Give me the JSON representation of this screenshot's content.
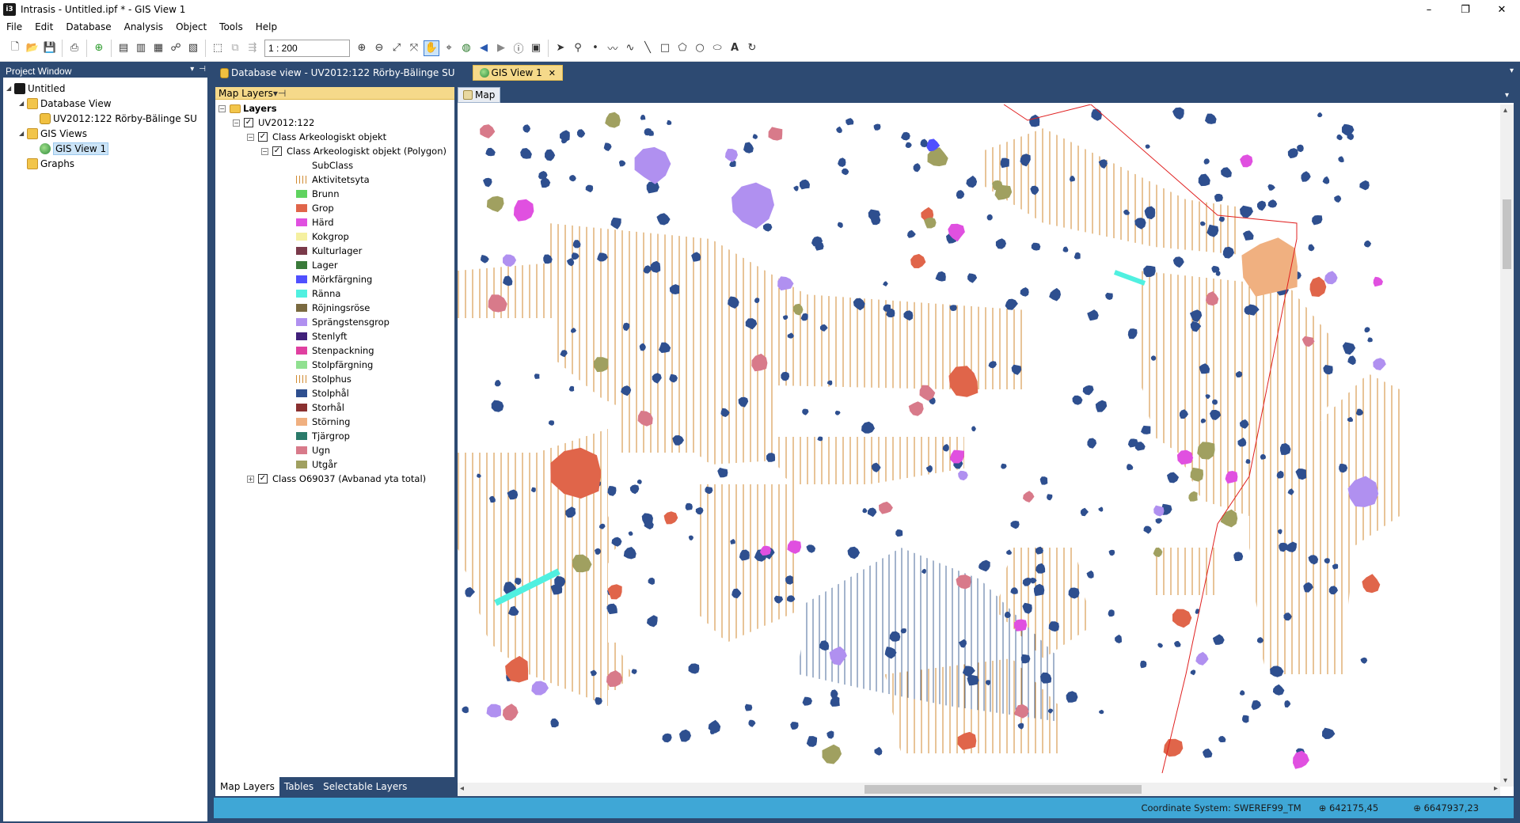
{
  "window": {
    "title": "Intrasis - Untitled.ipf * - GIS View 1",
    "app_icon": "i3"
  },
  "menu": [
    "File",
    "Edit",
    "Database",
    "Analysis",
    "Object",
    "Tools",
    "Help"
  ],
  "toolbar": {
    "scale_value": "1 : 200"
  },
  "project_window": {
    "title": "Project Window",
    "tree": [
      {
        "label": "Untitled",
        "icon": "app-icon",
        "level": 0,
        "expanded": true
      },
      {
        "label": "Database View",
        "icon": "folder-icon",
        "level": 1,
        "expanded": true
      },
      {
        "label": "UV2012:122 Rörby-Bälinge SU",
        "icon": "database-icon",
        "level": 2
      },
      {
        "label": "GIS Views",
        "icon": "folder-icon",
        "level": 1,
        "expanded": true
      },
      {
        "label": "GIS View 1",
        "icon": "globe-icon",
        "level": 2,
        "selected": true
      },
      {
        "label": "Graphs",
        "icon": "folder-icon",
        "level": 1
      }
    ]
  },
  "doc_tabs": [
    {
      "label": "Database view - UV2012:122 Rörby-Bälinge SU",
      "active": false
    },
    {
      "label": "GIS View 1",
      "active": true
    }
  ],
  "map_layers": {
    "title": "Map Layers",
    "root": "Layers",
    "project": "UV2012:122",
    "class1": "Class Arkeologiskt objekt",
    "class1_sub": "Class Arkeologiskt objekt (Polygon)",
    "subclass_header": "SubClass",
    "legend": [
      {
        "label": "Aktivitetsyta",
        "color": "hatch"
      },
      {
        "label": "Brunn",
        "color": "#5fd35f"
      },
      {
        "label": "Grop",
        "color": "#e0654a"
      },
      {
        "label": "Härd",
        "color": "#e050e0"
      },
      {
        "label": "Kokgrop",
        "color": "#f5f0a0"
      },
      {
        "label": "Kulturlager",
        "color": "#7a3a4a"
      },
      {
        "label": "Lager",
        "color": "#3a7a3a"
      },
      {
        "label": "Mörkfärgning",
        "color": "#5050ff"
      },
      {
        "label": "Ränna",
        "color": "#50f0e0"
      },
      {
        "label": "Röjningsröse",
        "color": "#7a6a40"
      },
      {
        "label": "Sprängstensgrop",
        "color": "#b090f0"
      },
      {
        "label": "Stenlyft",
        "color": "#40207a"
      },
      {
        "label": "Stenpackning",
        "color": "#e040a0"
      },
      {
        "label": "Stolpfärgning",
        "color": "#90e090"
      },
      {
        "label": "Stolphus",
        "color": "hatch"
      },
      {
        "label": "Stolphål",
        "color": "#2e4f8f"
      },
      {
        "label": "Storhål",
        "color": "#8a3030"
      },
      {
        "label": "Störning",
        "color": "#f0b080"
      },
      {
        "label": "Tjärgrop",
        "color": "#2a7a6a"
      },
      {
        "label": "Ugn",
        "color": "#d87a8a"
      },
      {
        "label": "Utgår",
        "color": "#a0a060"
      }
    ],
    "class2": "Class O69037 (Avbanad yta total)",
    "bottom_tabs": [
      "Map Layers",
      "Tables",
      "Selectable Layers"
    ]
  },
  "map": {
    "tab_label": "Map"
  },
  "status": {
    "coordinate_system": "Coordinate System: SWEREF99_TM",
    "x": "642175,45",
    "y": "6647937,23"
  },
  "colors": {
    "workspace": "#2d4a72",
    "tab_active": "#f5d98a",
    "status_bar": "#3fa7d6",
    "hatch_orange": "#d08a30",
    "hatch_blue": "#4a6a9a",
    "boundary_red": "#e02020"
  }
}
